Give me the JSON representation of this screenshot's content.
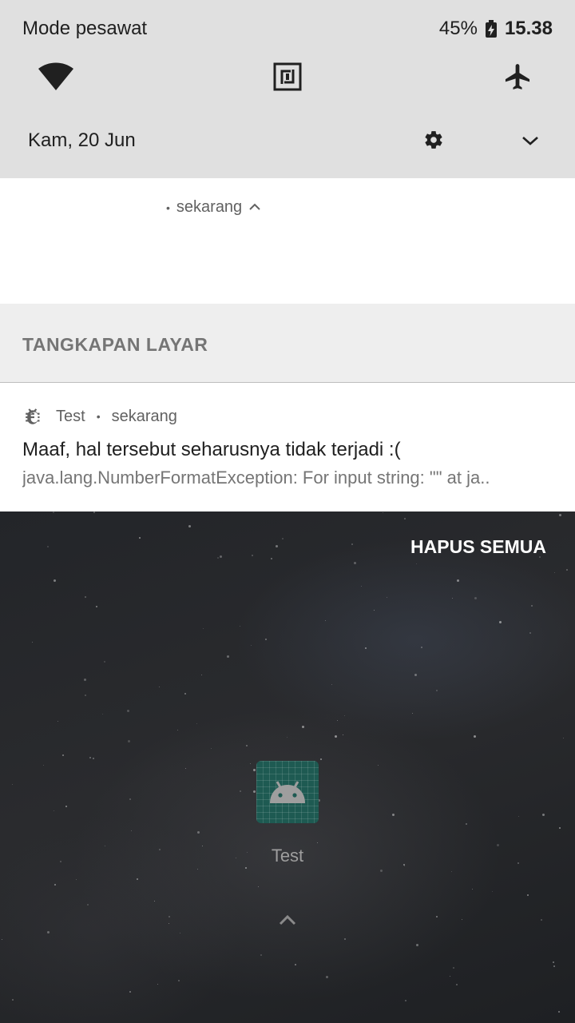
{
  "status_bar": {
    "mode": "Mode pesawat",
    "battery": "45%",
    "time": "15.38"
  },
  "quick_settings": {
    "tiles": [
      {
        "icon": "wifi-icon"
      },
      {
        "icon": "nfc-icon"
      },
      {
        "icon": "airplane-mode-icon"
      }
    ],
    "date": "Kam, 20 Jun"
  },
  "expanded_notification": {
    "time": "sekarang"
  },
  "section": {
    "title": "TANGKAPAN LAYAR"
  },
  "notification": {
    "app_name": "Test",
    "time": "sekarang",
    "title": "Maaf, hal tersebut seharusnya tidak terjadi :(",
    "text": "java.lang.NumberFormatException: For input string: \"\" at ja.."
  },
  "actions": {
    "clear_all": "HAPUS SEMUA"
  },
  "home": {
    "app_label": "Test"
  },
  "colors": {
    "qs_background": "#e0e0e0",
    "app_icon": "#1e5a52"
  }
}
